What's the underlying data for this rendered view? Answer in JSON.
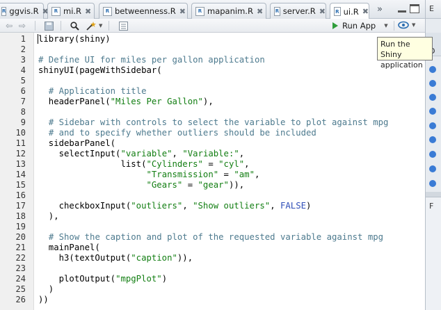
{
  "tabs": [
    {
      "label": "ggvis.R",
      "active": false
    },
    {
      "label": "mi.R",
      "active": false
    },
    {
      "label": "betweenness.R",
      "active": false
    },
    {
      "label": "mapanim.R",
      "active": false
    },
    {
      "label": "server.R",
      "active": false
    },
    {
      "label": "ui.R",
      "active": true
    }
  ],
  "tab_overflow_icon": "double-chevron-right",
  "toolbar": {
    "run_app_label": "Run App",
    "tooltip": "Run the Shiny application"
  },
  "right_panel": {
    "top_fragment": "E",
    "strip_fragment": "D",
    "bottom_fragment": "F"
  },
  "editor": {
    "language": "R",
    "lines": [
      [
        {
          "t": "library",
          "c": "p"
        },
        {
          "t": "(shiny)",
          "c": "p"
        }
      ],
      [],
      [
        {
          "t": "# Define UI for miles per gallon application",
          "c": "cmt"
        }
      ],
      [
        {
          "t": "shinyUI(pageWithSidebar(",
          "c": "p"
        }
      ],
      [],
      [
        {
          "t": "  ",
          "c": "p"
        },
        {
          "t": "# Application title",
          "c": "cmt"
        }
      ],
      [
        {
          "t": "  headerPanel(",
          "c": "p"
        },
        {
          "t": "\"Miles Per Gallon\"",
          "c": "str"
        },
        {
          "t": "),",
          "c": "p"
        }
      ],
      [],
      [
        {
          "t": "  ",
          "c": "p"
        },
        {
          "t": "# Sidebar with controls to select the variable to plot against mpg",
          "c": "cmt"
        }
      ],
      [
        {
          "t": "  ",
          "c": "p"
        },
        {
          "t": "# and to specify whether outliers should be included",
          "c": "cmt"
        }
      ],
      [
        {
          "t": "  sidebarPanel(",
          "c": "p"
        }
      ],
      [
        {
          "t": "    selectInput(",
          "c": "p"
        },
        {
          "t": "\"variable\"",
          "c": "str"
        },
        {
          "t": ", ",
          "c": "p"
        },
        {
          "t": "\"Variable:\"",
          "c": "str"
        },
        {
          "t": ",",
          "c": "p"
        }
      ],
      [
        {
          "t": "                list(",
          "c": "p"
        },
        {
          "t": "\"Cylinders\"",
          "c": "str"
        },
        {
          "t": " = ",
          "c": "p"
        },
        {
          "t": "\"cyl\"",
          "c": "str"
        },
        {
          "t": ",",
          "c": "p"
        }
      ],
      [
        {
          "t": "                     ",
          "c": "p"
        },
        {
          "t": "\"Transmission\"",
          "c": "str"
        },
        {
          "t": " = ",
          "c": "p"
        },
        {
          "t": "\"am\"",
          "c": "str"
        },
        {
          "t": ",",
          "c": "p"
        }
      ],
      [
        {
          "t": "                     ",
          "c": "p"
        },
        {
          "t": "\"Gears\"",
          "c": "str"
        },
        {
          "t": " = ",
          "c": "p"
        },
        {
          "t": "\"gear\"",
          "c": "str"
        },
        {
          "t": ")),",
          "c": "p"
        }
      ],
      [],
      [
        {
          "t": "    checkboxInput(",
          "c": "p"
        },
        {
          "t": "\"outliers\"",
          "c": "str"
        },
        {
          "t": ", ",
          "c": "p"
        },
        {
          "t": "\"Show outliers\"",
          "c": "str"
        },
        {
          "t": ", ",
          "c": "p"
        },
        {
          "t": "FALSE",
          "c": "kw"
        },
        {
          "t": ")",
          "c": "p"
        }
      ],
      [
        {
          "t": "  ),",
          "c": "p"
        }
      ],
      [],
      [
        {
          "t": "  ",
          "c": "p"
        },
        {
          "t": "# Show the caption and plot of the requested variable against mpg",
          "c": "cmt"
        }
      ],
      [
        {
          "t": "  mainPanel(",
          "c": "p"
        }
      ],
      [
        {
          "t": "    h3(textOutput(",
          "c": "p"
        },
        {
          "t": "\"caption\"",
          "c": "str"
        },
        {
          "t": ")),",
          "c": "p"
        }
      ],
      [],
      [
        {
          "t": "    plotOutput(",
          "c": "p"
        },
        {
          "t": "\"mpgPlot\"",
          "c": "str"
        },
        {
          "t": ")",
          "c": "p"
        }
      ],
      [
        {
          "t": "  )",
          "c": "p"
        }
      ],
      [
        {
          "t": "))",
          "c": "p"
        }
      ]
    ]
  },
  "colors": {
    "comment": "#4d7a8e",
    "string": "#127e12",
    "keyword": "#2f4eb8",
    "run_icon": "#2f9d3b"
  }
}
